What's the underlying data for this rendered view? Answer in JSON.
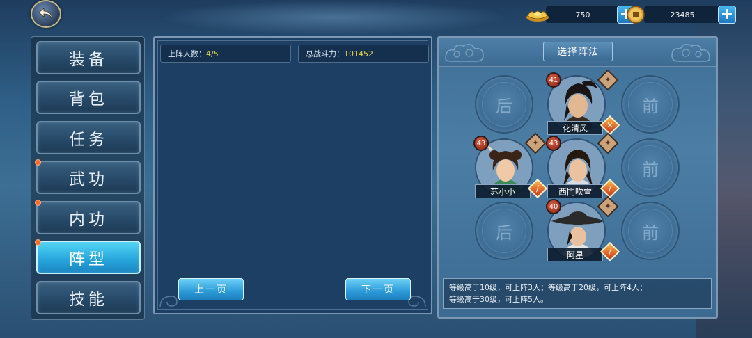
{
  "resources": {
    "gold": {
      "icon": "gold-ingot-icon",
      "value": "750",
      "add": "+"
    },
    "coin": {
      "icon": "copper-coin-icon",
      "value": "23485",
      "add": "+"
    }
  },
  "sidebar": {
    "items": [
      {
        "label": "装备",
        "active": false,
        "dot": false
      },
      {
        "label": "背包",
        "active": false,
        "dot": false
      },
      {
        "label": "任务",
        "active": false,
        "dot": false
      },
      {
        "label": "武功",
        "active": false,
        "dot": true
      },
      {
        "label": "内功",
        "active": false,
        "dot": true
      },
      {
        "label": "阵型",
        "active": true,
        "dot": true
      },
      {
        "label": "技能",
        "active": false,
        "dot": false
      }
    ]
  },
  "roster": {
    "deployed_label": "上阵人数：",
    "deployed_value": "4/5",
    "power_label": "总战斗力：",
    "power_value": "101452",
    "prev_page": "上一页",
    "next_page": "下一页"
  },
  "formation": {
    "title": "选择阵法",
    "back_label": "后",
    "front_label": "前",
    "heroes": {
      "top": {
        "name": "化清风",
        "level": "41"
      },
      "mid_left": {
        "name": "苏小小",
        "level": "43"
      },
      "mid_center": {
        "name": "西門吹雪",
        "level": "43"
      },
      "bottom": {
        "name": "阿星",
        "level": "40"
      }
    },
    "rule_line1": "等级高于10级，可上阵3人；等级高于20级，可上阵4人；",
    "rule_line2": "等级高于30级，可上阵5人。"
  },
  "colors": {
    "accent_blue": "#28a8dc",
    "highlight_yellow": "#e8d34a",
    "level_red": "#c8321e"
  }
}
